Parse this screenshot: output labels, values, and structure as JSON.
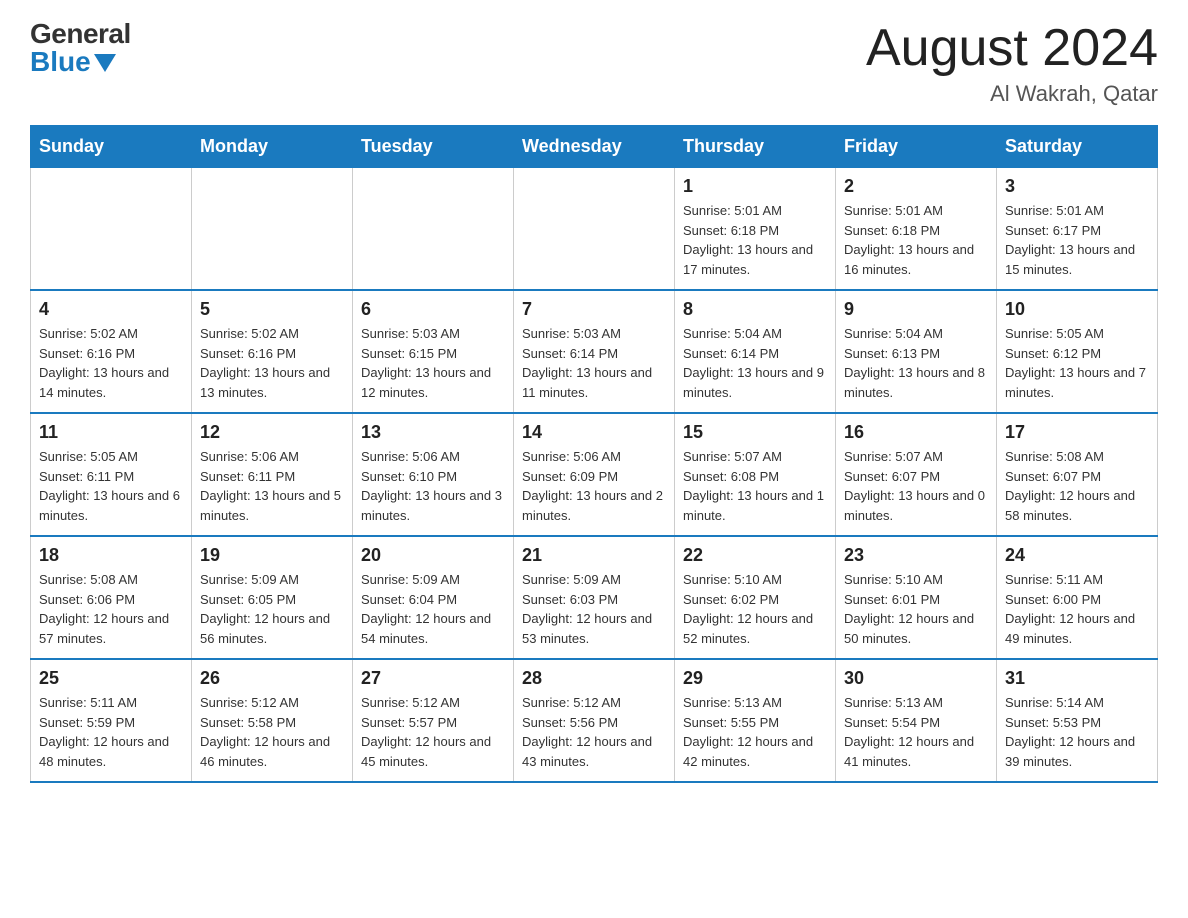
{
  "header": {
    "logo_general": "General",
    "logo_blue": "Blue",
    "month_title": "August 2024",
    "location": "Al Wakrah, Qatar"
  },
  "weekdays": [
    "Sunday",
    "Monday",
    "Tuesday",
    "Wednesday",
    "Thursday",
    "Friday",
    "Saturday"
  ],
  "weeks": [
    [
      {
        "num": "",
        "info": ""
      },
      {
        "num": "",
        "info": ""
      },
      {
        "num": "",
        "info": ""
      },
      {
        "num": "",
        "info": ""
      },
      {
        "num": "1",
        "info": "Sunrise: 5:01 AM\nSunset: 6:18 PM\nDaylight: 13 hours and 17 minutes."
      },
      {
        "num": "2",
        "info": "Sunrise: 5:01 AM\nSunset: 6:18 PM\nDaylight: 13 hours and 16 minutes."
      },
      {
        "num": "3",
        "info": "Sunrise: 5:01 AM\nSunset: 6:17 PM\nDaylight: 13 hours and 15 minutes."
      }
    ],
    [
      {
        "num": "4",
        "info": "Sunrise: 5:02 AM\nSunset: 6:16 PM\nDaylight: 13 hours and 14 minutes."
      },
      {
        "num": "5",
        "info": "Sunrise: 5:02 AM\nSunset: 6:16 PM\nDaylight: 13 hours and 13 minutes."
      },
      {
        "num": "6",
        "info": "Sunrise: 5:03 AM\nSunset: 6:15 PM\nDaylight: 13 hours and 12 minutes."
      },
      {
        "num": "7",
        "info": "Sunrise: 5:03 AM\nSunset: 6:14 PM\nDaylight: 13 hours and 11 minutes."
      },
      {
        "num": "8",
        "info": "Sunrise: 5:04 AM\nSunset: 6:14 PM\nDaylight: 13 hours and 9 minutes."
      },
      {
        "num": "9",
        "info": "Sunrise: 5:04 AM\nSunset: 6:13 PM\nDaylight: 13 hours and 8 minutes."
      },
      {
        "num": "10",
        "info": "Sunrise: 5:05 AM\nSunset: 6:12 PM\nDaylight: 13 hours and 7 minutes."
      }
    ],
    [
      {
        "num": "11",
        "info": "Sunrise: 5:05 AM\nSunset: 6:11 PM\nDaylight: 13 hours and 6 minutes."
      },
      {
        "num": "12",
        "info": "Sunrise: 5:06 AM\nSunset: 6:11 PM\nDaylight: 13 hours and 5 minutes."
      },
      {
        "num": "13",
        "info": "Sunrise: 5:06 AM\nSunset: 6:10 PM\nDaylight: 13 hours and 3 minutes."
      },
      {
        "num": "14",
        "info": "Sunrise: 5:06 AM\nSunset: 6:09 PM\nDaylight: 13 hours and 2 minutes."
      },
      {
        "num": "15",
        "info": "Sunrise: 5:07 AM\nSunset: 6:08 PM\nDaylight: 13 hours and 1 minute."
      },
      {
        "num": "16",
        "info": "Sunrise: 5:07 AM\nSunset: 6:07 PM\nDaylight: 13 hours and 0 minutes."
      },
      {
        "num": "17",
        "info": "Sunrise: 5:08 AM\nSunset: 6:07 PM\nDaylight: 12 hours and 58 minutes."
      }
    ],
    [
      {
        "num": "18",
        "info": "Sunrise: 5:08 AM\nSunset: 6:06 PM\nDaylight: 12 hours and 57 minutes."
      },
      {
        "num": "19",
        "info": "Sunrise: 5:09 AM\nSunset: 6:05 PM\nDaylight: 12 hours and 56 minutes."
      },
      {
        "num": "20",
        "info": "Sunrise: 5:09 AM\nSunset: 6:04 PM\nDaylight: 12 hours and 54 minutes."
      },
      {
        "num": "21",
        "info": "Sunrise: 5:09 AM\nSunset: 6:03 PM\nDaylight: 12 hours and 53 minutes."
      },
      {
        "num": "22",
        "info": "Sunrise: 5:10 AM\nSunset: 6:02 PM\nDaylight: 12 hours and 52 minutes."
      },
      {
        "num": "23",
        "info": "Sunrise: 5:10 AM\nSunset: 6:01 PM\nDaylight: 12 hours and 50 minutes."
      },
      {
        "num": "24",
        "info": "Sunrise: 5:11 AM\nSunset: 6:00 PM\nDaylight: 12 hours and 49 minutes."
      }
    ],
    [
      {
        "num": "25",
        "info": "Sunrise: 5:11 AM\nSunset: 5:59 PM\nDaylight: 12 hours and 48 minutes."
      },
      {
        "num": "26",
        "info": "Sunrise: 5:12 AM\nSunset: 5:58 PM\nDaylight: 12 hours and 46 minutes."
      },
      {
        "num": "27",
        "info": "Sunrise: 5:12 AM\nSunset: 5:57 PM\nDaylight: 12 hours and 45 minutes."
      },
      {
        "num": "28",
        "info": "Sunrise: 5:12 AM\nSunset: 5:56 PM\nDaylight: 12 hours and 43 minutes."
      },
      {
        "num": "29",
        "info": "Sunrise: 5:13 AM\nSunset: 5:55 PM\nDaylight: 12 hours and 42 minutes."
      },
      {
        "num": "30",
        "info": "Sunrise: 5:13 AM\nSunset: 5:54 PM\nDaylight: 12 hours and 41 minutes."
      },
      {
        "num": "31",
        "info": "Sunrise: 5:14 AM\nSunset: 5:53 PM\nDaylight: 12 hours and 39 minutes."
      }
    ]
  ]
}
